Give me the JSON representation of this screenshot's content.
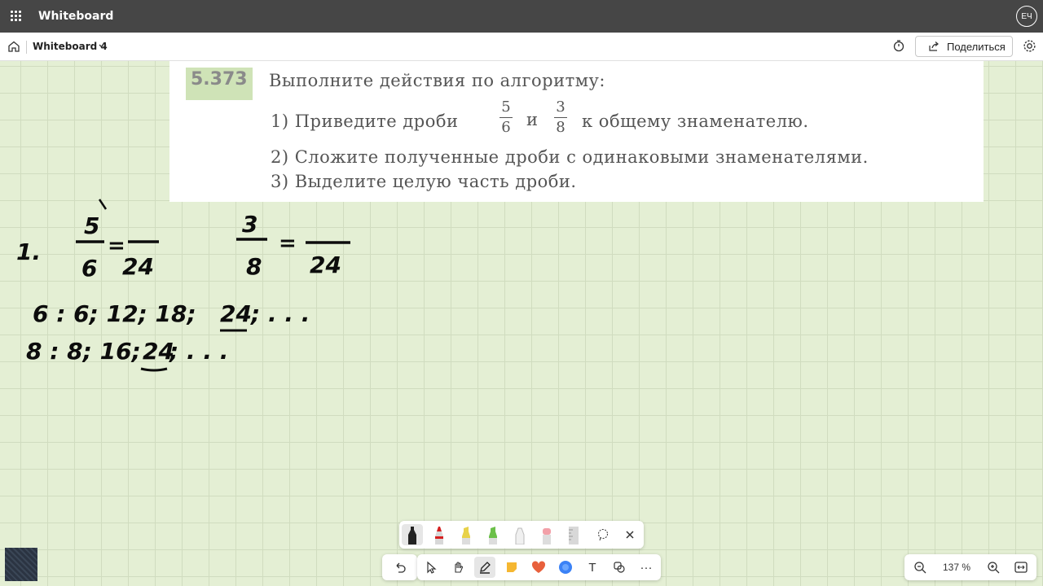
{
  "titlebar": {
    "app_name": "Whiteboard",
    "avatar_initials": "ЕЧ",
    "apps_icon": "app-launcher-icon"
  },
  "commandbar": {
    "board_name": "Whiteboard 4",
    "share_label": "Поделиться",
    "icons": [
      "home-icon",
      "chevron-down-icon",
      "timer-icon",
      "share-icon",
      "gear-icon"
    ]
  },
  "problem": {
    "number": "5.373",
    "heading": "Выполните действия по алгоритму:",
    "step1_a": "1) Приведите дроби",
    "frac1_num": "5",
    "frac1_den": "6",
    "step1_and": "и",
    "frac2_num": "3",
    "frac2_den": "8",
    "step1_b": "к общему знаменателю.",
    "step2": "2) Сложите полученные дроби с одинаковыми знаменателями.",
    "step3": "3) Выделите целую часть дроби."
  },
  "handwriting": {
    "item": "1.",
    "f1_num": "5",
    "f1_den": "6",
    "eq": "=",
    "f1_new_den": "24",
    "f2_num": "3",
    "f2_den": "8",
    "f2_new_den": "24",
    "row6": "6 : 6; 12; 18;",
    "row6_hl": "24",
    "row6_end": "; . . .",
    "row8": "8 : 8; 16;",
    "row8_hl": "24",
    "row8_end": "; . . ."
  },
  "pen_tray": [
    "black-pen-icon",
    "red-pen-icon",
    "yellow-highlighter-icon",
    "green-highlighter-icon",
    "white-pen-icon",
    "eraser-icon",
    "ruler-icon",
    "lasso-icon",
    "close-icon"
  ],
  "toolbar": {
    "undo_icon": "undo-icon",
    "tools": [
      "select-icon",
      "hand-icon",
      "pen-icon",
      "sticky-note-icon",
      "reactions-icon",
      "shapes-icon",
      "text-icon",
      "link-icon",
      "more-icon"
    ],
    "text_glyph": "T",
    "more_glyph": "···"
  },
  "zoom": {
    "level": "137 %"
  },
  "colors": {
    "titlebar": "#464646",
    "canvas": "#e4efd4",
    "ink": "#0c0c0c"
  }
}
